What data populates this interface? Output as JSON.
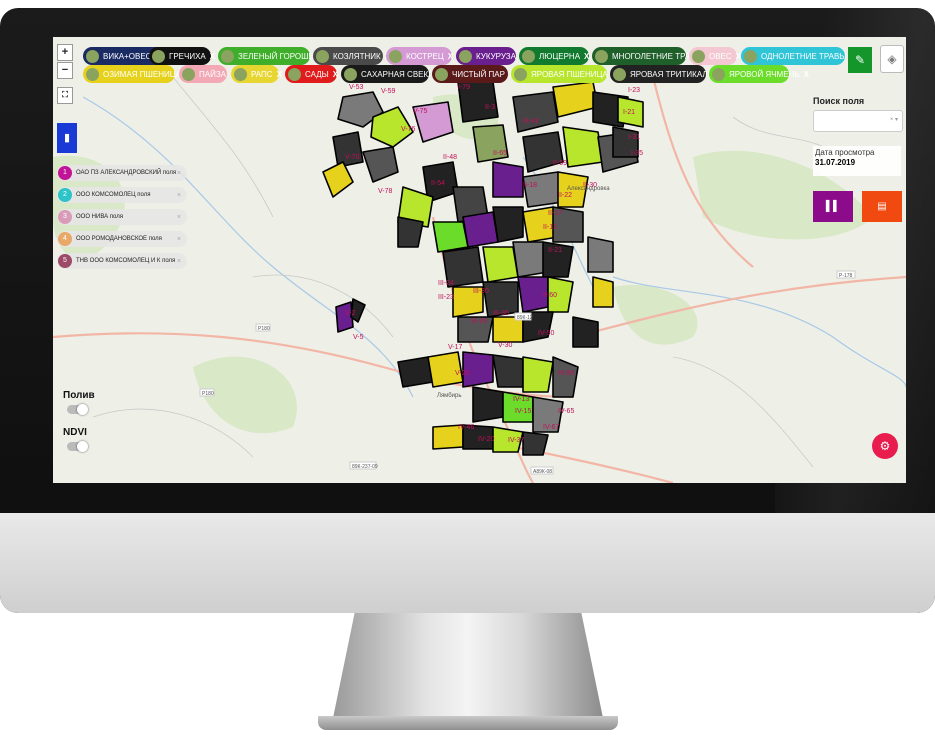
{
  "map": {
    "zoom_in": "+",
    "zoom_out": "−",
    "fullscreen_icon": "fullscreen-icon",
    "home_icon": "building-icon"
  },
  "filter_chips": [
    {
      "label": "ВИКА+ОВЕС",
      "close": "X",
      "color": "#1a2a63"
    },
    {
      "label": "ГРЕЧИХА",
      "close": "X",
      "color": "#111111"
    },
    {
      "label": "ЗЕЛЕНЫЙ ГОРОШЕК",
      "close": "X",
      "color": "#3fae2a"
    },
    {
      "label": "КОЗЛЯТНИК",
      "close": "X",
      "color": "#4a4a4a"
    },
    {
      "label": "КОСТРЕЦ",
      "close": "X",
      "color": "#d39ad4"
    },
    {
      "label": "КУКУРУЗА",
      "close": "X",
      "color": "#6a1f8f"
    },
    {
      "label": "ЛЮЦЕРНА",
      "close": "X",
      "color": "#127a2e"
    },
    {
      "label": "МНОГОЛЕТНИЕ ТРАВЫ",
      "close": "X",
      "color": "#1f5f2a"
    },
    {
      "label": "ОВЕС",
      "close": "X",
      "color": "#f4c8d2"
    },
    {
      "label": "ОДНОЛЕТНИЕ ТРАВЫ",
      "close": "X",
      "color": "#2fc4d6"
    },
    {
      "label": "ОЗИМАЯ ПШЕНИЦА",
      "close": "X",
      "color": "#e6d21c"
    },
    {
      "label": "ПАЙЗА",
      "close": "X",
      "color": "#f3a8b6"
    },
    {
      "label": "РАПС",
      "close": "X",
      "color": "#e7d632"
    },
    {
      "label": "САДЫ",
      "close": "X",
      "color": "#e01b1b"
    },
    {
      "label": "САХАРНАЯ СВЕКЛА",
      "close": "X",
      "color": "#1a1a1a"
    },
    {
      "label": "ЧИСТЫЙ ПАР",
      "close": "X",
      "color": "#5a1a1a"
    },
    {
      "label": "ЯРОВАЯ ПШЕНИЦА",
      "close": "X",
      "color": "#b8e62c"
    },
    {
      "label": "ЯРОВАЯ ТРИТИКАЛЕ",
      "close": "X",
      "color": "#222222"
    },
    {
      "label": "ЯРОВОЙ ЯЧМЕНЬ",
      "close": "X",
      "color": "#6bdc2a"
    }
  ],
  "farms": [
    {
      "num": "1",
      "label": "ОАО ПЗ АЛЕКСАНДРОВСКИЙ поля",
      "color": "#c21497"
    },
    {
      "num": "2",
      "label": "ООО КОМСОМОЛЕЦ поля",
      "color": "#2cc4c8"
    },
    {
      "num": "3",
      "label": "ООО НИВА поля",
      "color": "#d99bb8"
    },
    {
      "num": "4",
      "label": "ООО РОМОДАНОВСКОЕ поля",
      "color": "#e8a868"
    },
    {
      "num": "5",
      "label": "ТНВ ООО КОМСОМОЛЕЦ И К поля",
      "color": "#9c4a68"
    }
  ],
  "farm_close": "×",
  "toggles": {
    "poliv": "Полив",
    "ndvi": "NDVI"
  },
  "search": {
    "label": "Поиск поля",
    "clear": "× ▾"
  },
  "date": {
    "label": "Дата просмотра",
    "value": "31.07.2019"
  },
  "field_labels": [
    "V-53",
    "V-59",
    "I-79",
    "II-3",
    "I-23",
    "I-21",
    "I-31",
    "I-35",
    "III-42",
    "II-65",
    "II-48",
    "II-59",
    "V-75",
    "V-76",
    "V-78",
    "V-70",
    "II-54",
    "II-18",
    "II-22",
    "II-21",
    "II-30",
    "II-17",
    "II-12",
    "II-60",
    "III-23",
    "III-24",
    "III-30",
    "III-36",
    "III-28",
    "V-2",
    "V-5",
    "V-17",
    "V-20",
    "V-30",
    "IV-50",
    "IV-55",
    "IV-13",
    "IV-15",
    "IV-67",
    "IV-65",
    "IV-46",
    "IV-37",
    "IV-20"
  ],
  "road_labels": [
    "Р-178",
    "Р180",
    "89К-12",
    "Р180",
    "89К-237-09",
    "А89К-08"
  ],
  "town_labels": [
    "Лямбирь",
    "Александровка"
  ]
}
